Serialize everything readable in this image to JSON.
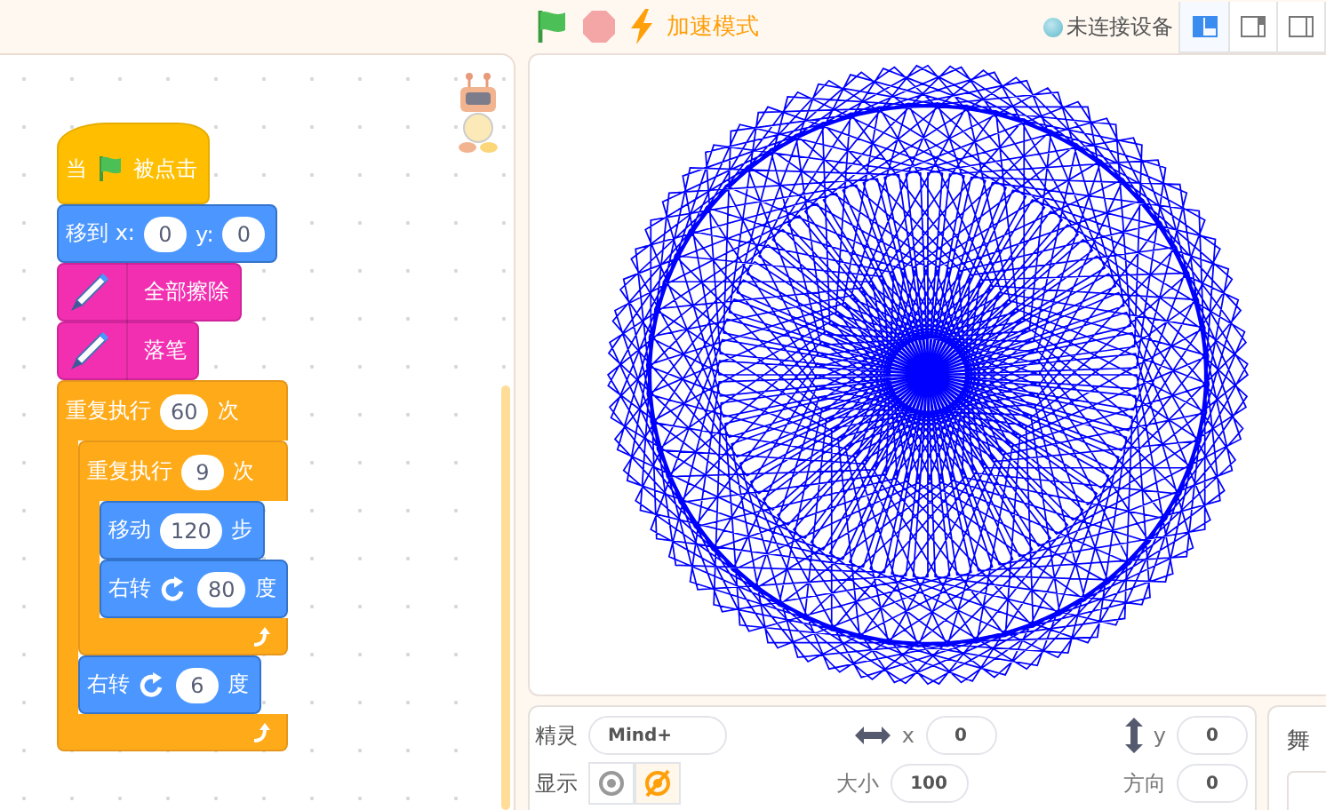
{
  "toolbar": {
    "turbo_label": "加速模式",
    "device_status": "未连接设备",
    "layout_buttons": [
      {
        "kind": "small-stage",
        "selected": true
      },
      {
        "kind": "large-stage",
        "selected": false
      },
      {
        "kind": "full-stage",
        "selected": false
      }
    ]
  },
  "script": {
    "blocks": [
      {
        "kind": "event",
        "parts": [
          {
            "kind": "text",
            "text": "当"
          },
          {
            "kind": "flag"
          },
          {
            "kind": "text",
            "text": "被点击"
          }
        ]
      },
      {
        "kind": "motion",
        "parts": [
          {
            "kind": "text",
            "text": "移到 x:"
          },
          {
            "kind": "input",
            "text": "0"
          },
          {
            "kind": "text",
            "text": "y:"
          },
          {
            "kind": "input",
            "text": "0"
          }
        ]
      },
      {
        "kind": "pen",
        "parts": [
          {
            "kind": "pen"
          },
          {
            "kind": "text",
            "text": "全部擦除"
          }
        ]
      },
      {
        "kind": "pen",
        "parts": [
          {
            "kind": "pen"
          },
          {
            "kind": "text",
            "text": "落笔"
          }
        ]
      },
      {
        "kind": "control",
        "parts": [
          {
            "kind": "text",
            "text": "重复执行"
          },
          {
            "kind": "input",
            "text": "60"
          },
          {
            "kind": "text",
            "text": "次"
          }
        ],
        "children": [
          {
            "kind": "control",
            "parts": [
              {
                "kind": "text",
                "text": "重复执行"
              },
              {
                "kind": "input",
                "text": "9"
              },
              {
                "kind": "text",
                "text": "次"
              }
            ],
            "children": [
              {
                "kind": "motion",
                "parts": [
                  {
                    "kind": "text",
                    "text": "移动"
                  },
                  {
                    "kind": "input",
                    "text": "120"
                  },
                  {
                    "kind": "text",
                    "text": "步"
                  }
                ]
              },
              {
                "kind": "motion",
                "parts": [
                  {
                    "kind": "text",
                    "text": "右转"
                  },
                  {
                    "kind": "turn"
                  },
                  {
                    "kind": "input",
                    "text": "80"
                  },
                  {
                    "kind": "text",
                    "text": "度"
                  }
                ]
              }
            ]
          },
          {
            "kind": "motion",
            "parts": [
              {
                "kind": "text",
                "text": "右转"
              },
              {
                "kind": "turn"
              },
              {
                "kind": "input",
                "text": "6"
              },
              {
                "kind": "text",
                "text": "度"
              }
            ]
          }
        ]
      }
    ]
  },
  "sprite_panel": {
    "sprite_label": "精灵",
    "sprite_name": "Mind+",
    "x_label": "x",
    "x_value": "0",
    "y_label": "y",
    "y_value": "0",
    "show_label": "显示",
    "show_buttons": [
      {
        "kind": "show",
        "selected": false
      },
      {
        "kind": "hide",
        "selected": true
      }
    ],
    "size_label": "大小",
    "size_value": "100",
    "direction_label": "方向",
    "direction_value": "0"
  },
  "stage_panel": {
    "title": "舞"
  }
}
